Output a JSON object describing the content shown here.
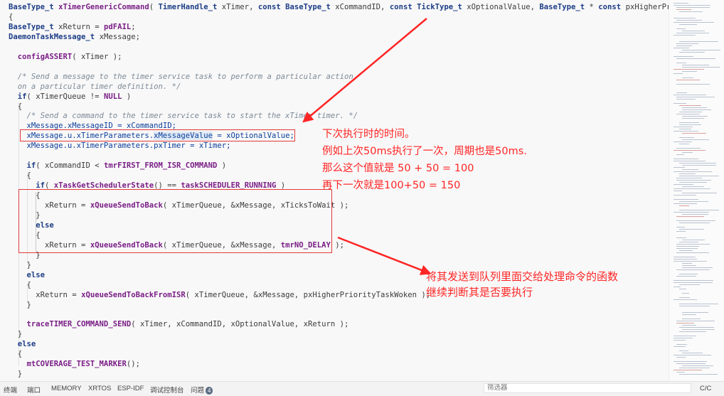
{
  "code": {
    "lines": [
      [
        {
          "t": "BaseType_t ",
          "c": "kw"
        },
        {
          "t": "xTimerGenericCommand",
          "c": "fn"
        },
        {
          "t": "( "
        },
        {
          "t": "TimerHandle_t ",
          "c": "kw"
        },
        {
          "t": "xTimer, "
        },
        {
          "t": "const ",
          "c": "kw"
        },
        {
          "t": "BaseType_t ",
          "c": "kw"
        },
        {
          "t": "xCommandID, "
        },
        {
          "t": "const ",
          "c": "kw"
        },
        {
          "t": "TickType_t ",
          "c": "kw"
        },
        {
          "t": "xOptionalValue, "
        },
        {
          "t": "BaseType_t ",
          "c": "kw"
        },
        {
          "t": "* "
        },
        {
          "t": "const ",
          "c": "kw"
        },
        {
          "t": "pxHigherPriorityTaskWoken, c"
        }
      ],
      [
        {
          "t": "{"
        }
      ],
      [
        {
          "t": "BaseType_t ",
          "c": "kw"
        },
        {
          "t": "xReturn = "
        },
        {
          "t": "pdFAIL",
          "c": "mac"
        },
        {
          "t": ";"
        }
      ],
      [
        {
          "t": "DaemonTaskMessage_t ",
          "c": "kw"
        },
        {
          "t": "xMessage;"
        }
      ],
      [],
      [
        {
          "t": "  configASSERT",
          "c": "fn"
        },
        {
          "t": "( xTimer );"
        }
      ],
      [],
      [
        {
          "t": "  /* Send a message to the timer service task to perform a particular action",
          "c": "cm"
        }
      ],
      [
        {
          "t": "  on a particular timer definition. */",
          "c": "cm"
        }
      ],
      [
        {
          "t": "  if",
          "c": "kw"
        },
        {
          "t": "( xTimerQueue != "
        },
        {
          "t": "NULL",
          "c": "mac"
        },
        {
          "t": " )"
        }
      ],
      [
        {
          "t": "  {"
        }
      ],
      [
        {
          "t": "    /* Send a command to the timer service task to start the xTimer timer. */",
          "c": "cm"
        }
      ],
      [
        {
          "t": "    xMessage.xMessageID = xCommandID;",
          "c": "vr"
        }
      ],
      [
        {
          "t": "    xMessage.u.xTimerParameters.",
          "c": "vr"
        },
        {
          "t": "xMessageValue",
          "c": "vr hl"
        },
        {
          "t": " = xOptionalValue;",
          "c": "vr"
        }
      ],
      [
        {
          "t": "    xMessage.u.xTimerParameters.pxTimer = xTimer;",
          "c": "vr"
        }
      ],
      [],
      [
        {
          "t": "    if",
          "c": "kw"
        },
        {
          "t": "( xCommandID < "
        },
        {
          "t": "tmrFIRST_FROM_ISR_COMMAND",
          "c": "mac"
        },
        {
          "t": " )"
        }
      ],
      [
        {
          "t": "    {"
        }
      ],
      [
        {
          "t": "      if",
          "c": "kw"
        },
        {
          "t": "( "
        },
        {
          "t": "xTaskGetSchedulerState",
          "c": "fn"
        },
        {
          "t": "() == "
        },
        {
          "t": "taskSCHEDULER_RUNNING",
          "c": "mac"
        },
        {
          "t": " )"
        }
      ],
      [
        {
          "t": "      {"
        }
      ],
      [
        {
          "t": "        xReturn = "
        },
        {
          "t": "xQueueSendToBack",
          "c": "fn"
        },
        {
          "t": "( xTimerQueue, &xMessage, xTicksToWait );"
        }
      ],
      [
        {
          "t": "      }"
        }
      ],
      [
        {
          "t": "      else",
          "c": "kw"
        }
      ],
      [
        {
          "t": "      {"
        }
      ],
      [
        {
          "t": "        xReturn = "
        },
        {
          "t": "xQueueSendToBack",
          "c": "fn"
        },
        {
          "t": "( xTimerQueue, &xMessage, "
        },
        {
          "t": "tmrNO_DELAY",
          "c": "mac"
        },
        {
          "t": " );"
        }
      ],
      [
        {
          "t": "      }"
        }
      ],
      [
        {
          "t": "    }"
        }
      ],
      [
        {
          "t": "    else",
          "c": "kw"
        }
      ],
      [
        {
          "t": "    {"
        }
      ],
      [
        {
          "t": "      xReturn = "
        },
        {
          "t": "xQueueSendToBackFromISR",
          "c": "fn"
        },
        {
          "t": "( xTimerQueue, &xMessage, pxHigherPriorityTaskWoken );"
        }
      ],
      [
        {
          "t": "    }"
        }
      ],
      [],
      [
        {
          "t": "    traceTIMER_COMMAND_SEND",
          "c": "fn"
        },
        {
          "t": "( xTimer, xCommandID, xOptionalValue, xReturn );"
        }
      ],
      [
        {
          "t": "  }"
        }
      ],
      [
        {
          "t": "  else",
          "c": "kw"
        }
      ],
      [
        {
          "t": "  {"
        }
      ],
      [
        {
          "t": "    mtCOVERAGE_TEST_MARKER",
          "c": "fn"
        },
        {
          "t": "();"
        }
      ],
      [
        {
          "t": "  }"
        }
      ]
    ]
  },
  "annotations": {
    "note1": [
      "下次执行时的时间。",
      "例如上次50ms执行了一次，周期也是50ms.",
      "那么这个值就是 50 + 50 = 100",
      "再下一次就是100+50 = 150"
    ],
    "note2": [
      "将其发送到队列里面交给处理命令的函数",
      "继续判断其是否要执行"
    ],
    "color": "#ff2525"
  },
  "statusbar": {
    "tabs": [
      {
        "label": "终端"
      },
      {
        "label": "端口"
      },
      {
        "label": "MEMORY"
      },
      {
        "label": "XRTOS"
      },
      {
        "label": "ESP-IDF"
      },
      {
        "label": "调试控制台"
      },
      {
        "label": "问题",
        "badge": "4"
      }
    ],
    "filter_placeholder": "筛选器",
    "language": "C/C"
  }
}
